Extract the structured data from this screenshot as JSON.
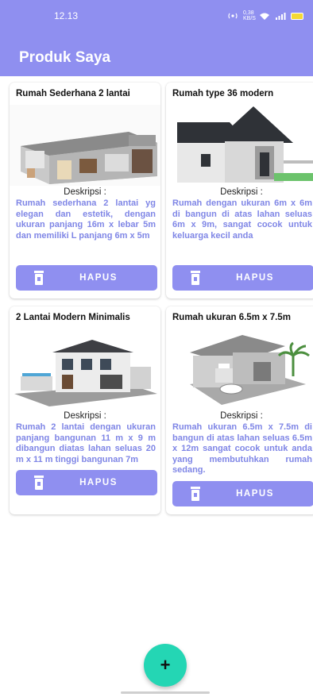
{
  "status_bar": {
    "time": "12.13",
    "net_speed": "0,38\nKB/S"
  },
  "app_bar": {
    "title": "Produk Saya"
  },
  "desc_label": "Deskripsi :",
  "products": [
    {
      "title": "Rumah Sederhana 2 lantai",
      "description": "Rumah sederhana 2 lantai yg elegan dan estetik, dengan ukuran panjang 16m x lebar 5m dan memiliki L panjang 6m x 5m",
      "button_label": "HAPUS"
    },
    {
      "title": "Rumah type 36 modern",
      "description": "Rumah dengan ukuran 6m x 6m di bangun di atas lahan seluas 6m x 9m, sangat cocok untuk keluarga kecil anda",
      "button_label": "HAPUS"
    },
    {
      "title": "2 Lantai Modern Minimalis",
      "description": "Rumah 2 lantai dengan ukuran panjang bangunan 11 m x 9 m dibangun diatas lahan seluas 20 m x 11 m tinggi bangunan 7m",
      "button_label": "HAPUS"
    },
    {
      "title": "Rumah ukuran 6.5m x 7.5m",
      "description": "Rumah ukuran 6.5m x 7.5m di bangun di atas lahan seluas 6.5m x 12m sangat cocok untuk anda yang membutuhkan rumah sedang.",
      "button_label": "HAPUS"
    }
  ],
  "fab": {
    "label": "+"
  },
  "colors": {
    "primary": "#8f8ff0",
    "description_text": "#7f86e6",
    "fab": "#24d6b4"
  },
  "icons": [
    "wifi-icon",
    "signal-icon",
    "battery-icon",
    "trash-icon",
    "plus-icon"
  ]
}
